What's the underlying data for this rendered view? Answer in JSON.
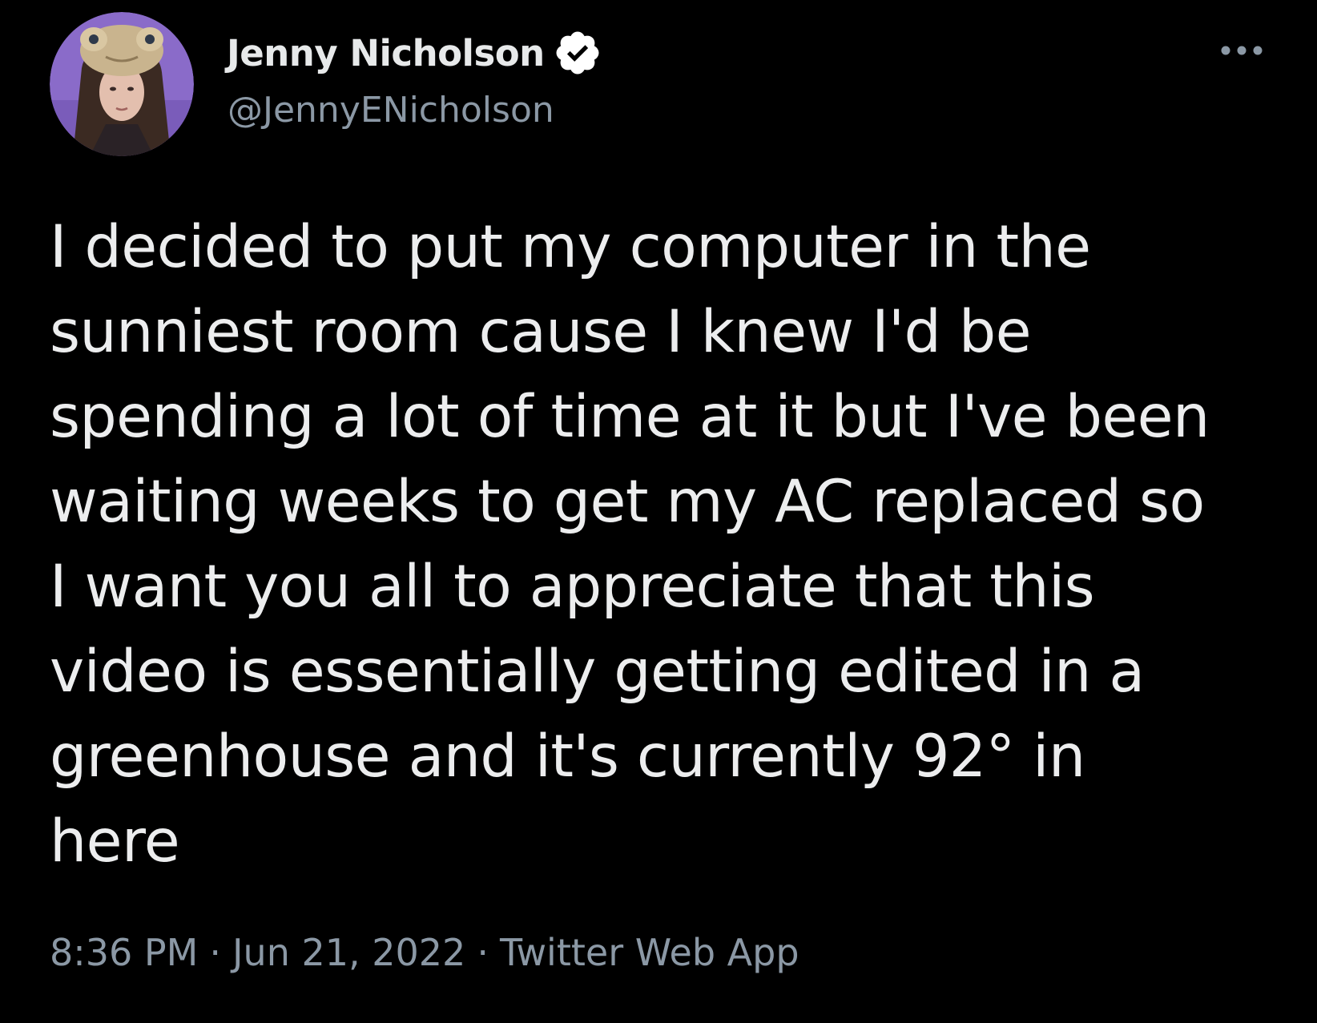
{
  "colors": {
    "background": "#000000",
    "primary_text": "#e7e9ea",
    "secondary_text": "#8b98a5",
    "avatar_background": "#8a6bc9",
    "verified_badge": "#ffffff"
  },
  "author": {
    "display_name": "Jenny Nicholson",
    "handle": "@JennyENicholson",
    "verified": true,
    "avatar_icon": "profile-photo",
    "verified_icon": "verified-badge-icon"
  },
  "more_button": {
    "icon": "more-options-icon"
  },
  "tweet": {
    "text": "I decided to put my computer in the\nsunniest room cause I knew I'd be\nspending a lot of time at it but I've been\nwaiting weeks to get my AC replaced so\nI want you all to appreciate that this\nvideo is essentially getting edited in a\ngreenhouse and it's currently 92° in\nhere"
  },
  "meta": {
    "time": "8:36 PM",
    "separator": "·",
    "date": "Jun 21, 2022",
    "source": "Twitter Web App"
  }
}
